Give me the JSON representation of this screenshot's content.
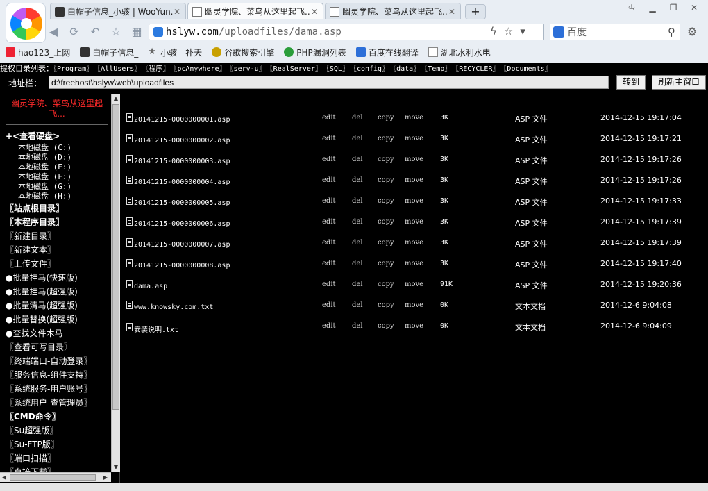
{
  "browser": {
    "tabs": [
      {
        "label": "白帽子信息_小骇 | WooYun.org",
        "icon": "hat-icon",
        "active": false
      },
      {
        "label": "幽灵学院、菜鸟从这里起飞...",
        "icon": "page-icon",
        "active": true
      },
      {
        "label": "幽灵学院、菜鸟从这里起飞...",
        "icon": "page-icon",
        "active": false
      }
    ],
    "new_tab": "+",
    "address": {
      "host": "hslyw.com",
      "path": "/uploadfiles/dama.asp"
    },
    "search_placeholder": "百度",
    "bookmarks": [
      {
        "label": "hao123_上网",
        "icon": "hao123-icon"
      },
      {
        "label": "白帽子信息_",
        "icon": "hat-icon"
      },
      {
        "label": "小骇 - 补天",
        "icon": "star-icon"
      },
      {
        "label": "谷歌搜索引擎",
        "icon": "google-icon"
      },
      {
        "label": "PHP漏洞列表",
        "icon": "php-icon"
      },
      {
        "label": "百度在线翻译",
        "icon": "translate-icon"
      },
      {
        "label": "湖北水利水电",
        "icon": "page-icon"
      }
    ]
  },
  "toprow": {
    "label": "提权目录列表：",
    "links": [
      "〖Program〗",
      "〖AllUsers〗",
      "〖程序〗",
      "〖pcAnywhere〗",
      "〖serv-u〗",
      "〖RealServer〗",
      "〖SQL〗",
      "〖config〗",
      "〖data〗",
      "〖Temp〗",
      "〖RECYCLER〗",
      "〖Documents〗"
    ]
  },
  "addrrow": {
    "label": "地址栏：",
    "value": "d:\\freehost\\hslyw\\web\\uploadfiles",
    "go_button": "转到",
    "refresh_button": "刷新主窗口"
  },
  "left": {
    "site_name": "幽灵学院、菜鸟从这里起飞...",
    "drives_header": "+<查看硬盘>",
    "drives": [
      "本地磁盘 (C:)",
      "本地磁盘 (D:)",
      "本地磁盘 (E:)",
      "本地磁盘 (F:)",
      "本地磁盘 (G:)",
      "本地磁盘 (H:)"
    ],
    "menu": [
      {
        "label": "〖站点根目录〗",
        "bold": true
      },
      {
        "label": "〖本程序目录〗",
        "bold": true
      },
      {
        "label": "〖新建目录〗",
        "bold": false
      },
      {
        "label": "〖新建文本〗",
        "bold": false
      },
      {
        "label": "〖上传文件〗",
        "bold": false
      },
      {
        "label": "●批量挂马(快速版)",
        "bold": false
      },
      {
        "label": "●批量挂马(超强版)",
        "bold": false
      },
      {
        "label": "●批量清马(超强版)",
        "bold": false
      },
      {
        "label": "●批量替换(超强版)",
        "bold": false
      },
      {
        "label": "●查找文件木马",
        "bold": false
      },
      {
        "label": "〖查看可写目录〗",
        "bold": false
      },
      {
        "label": "〖终端端口-自动登录〗",
        "bold": false
      },
      {
        "label": "〖服务信息-组件支持〗",
        "bold": false
      },
      {
        "label": "〖系统服务-用户账号〗",
        "bold": false
      },
      {
        "label": "〖系统用户-查管理员〗",
        "bold": false
      },
      {
        "label": "〖CMD命令〗",
        "bold": true
      },
      {
        "label": "〖Su超强版〗",
        "bold": false
      },
      {
        "label": "〖Su-FTP版〗",
        "bold": false
      },
      {
        "label": "〖端口扫描〗",
        "bold": false
      },
      {
        "label": "〖直接下载〗",
        "bold": false
      }
    ]
  },
  "files": {
    "actions": [
      "edit",
      "del",
      "copy",
      "move"
    ],
    "rows": [
      {
        "name": "20141215-0000000001.asp",
        "size": "3K",
        "type": "ASP 文件",
        "time": "2014-12-15 19:17:04"
      },
      {
        "name": "20141215-0000000002.asp",
        "size": "3K",
        "type": "ASP 文件",
        "time": "2014-12-15 19:17:21"
      },
      {
        "name": "20141215-0000000003.asp",
        "size": "3K",
        "type": "ASP 文件",
        "time": "2014-12-15 19:17:26"
      },
      {
        "name": "20141215-0000000004.asp",
        "size": "3K",
        "type": "ASP 文件",
        "time": "2014-12-15 19:17:26"
      },
      {
        "name": "20141215-0000000005.asp",
        "size": "3K",
        "type": "ASP 文件",
        "time": "2014-12-15 19:17:33"
      },
      {
        "name": "20141215-0000000006.asp",
        "size": "3K",
        "type": "ASP 文件",
        "time": "2014-12-15 19:17:39"
      },
      {
        "name": "20141215-0000000007.asp",
        "size": "3K",
        "type": "ASP 文件",
        "time": "2014-12-15 19:17:39"
      },
      {
        "name": "20141215-0000000008.asp",
        "size": "3K",
        "type": "ASP 文件",
        "time": "2014-12-15 19:17:40"
      },
      {
        "name": "dama.asp",
        "size": "91K",
        "type": "ASP 文件",
        "time": "2014-12-15 19:20:36"
      },
      {
        "name": "www.knowsky.com.txt",
        "size": "0K",
        "type": "文本文档",
        "time": "2014-12-6 9:04:08"
      },
      {
        "name": "安装说明.txt",
        "size": "0K",
        "type": "文本文档",
        "time": "2014-12-6 9:04:09"
      }
    ]
  }
}
